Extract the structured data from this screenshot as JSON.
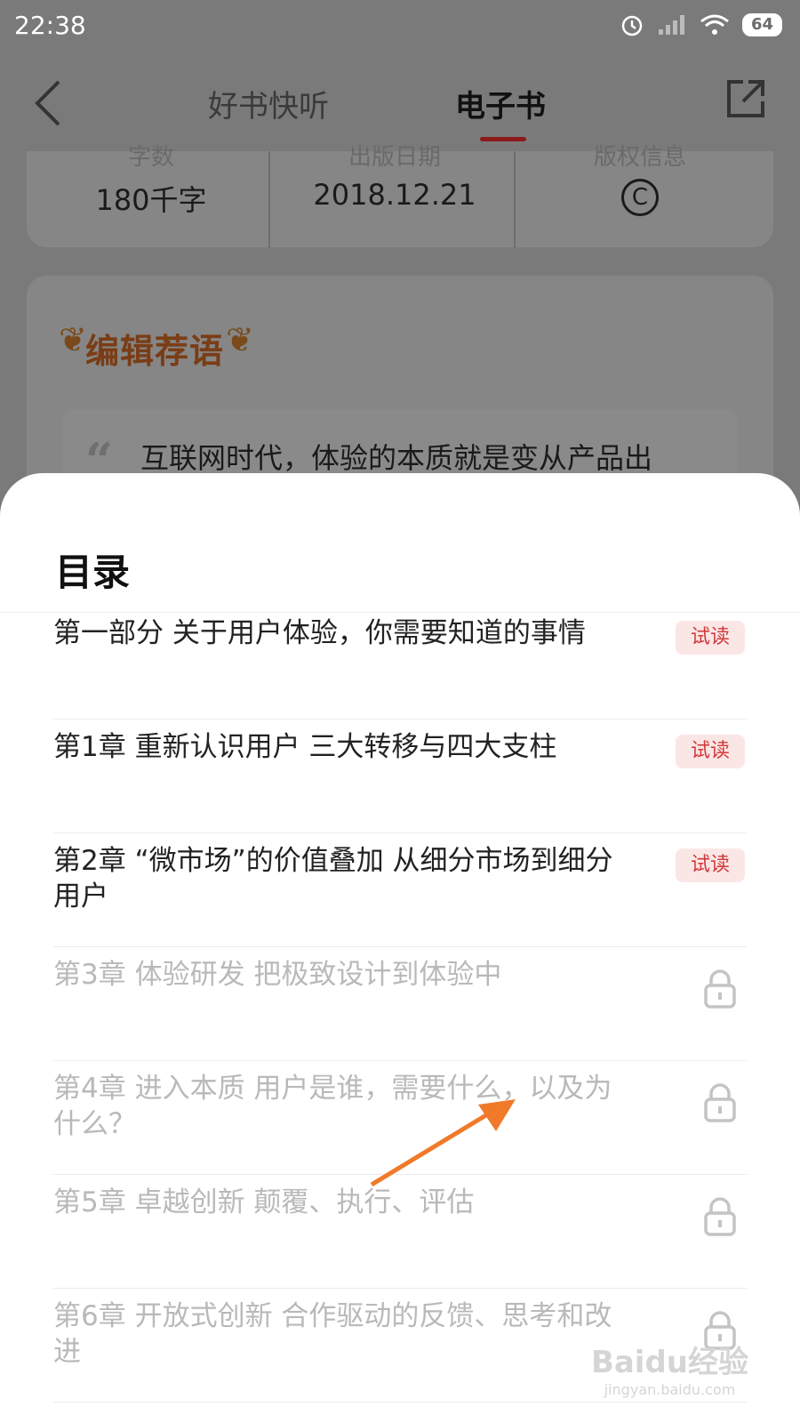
{
  "status_bar": {
    "time": "22:38",
    "battery": "64"
  },
  "nav": {
    "tab_listen": "好书快听",
    "tab_ebook": "电子书"
  },
  "info": {
    "words_label": "字数",
    "words_value": "180千字",
    "date_label": "出版日期",
    "date_value": "2018.12.21",
    "copyright_label": "版权信息",
    "copyright_symbol": "C"
  },
  "editor": {
    "title": "编辑荐语",
    "quote": "互联网时代，体验的本质就是变从产品出"
  },
  "toc": {
    "title": "目录",
    "trial_label": "试读",
    "items": [
      {
        "text": "第一部分 关于用户体验，你需要知道的事情",
        "status": "trial"
      },
      {
        "text": "第1章 重新认识用户 三大转移与四大支柱",
        "status": "trial"
      },
      {
        "text": "第2章 “微市场”的价值叠加 从细分市场到细分用户",
        "status": "trial"
      },
      {
        "text": "第3章 体验研发 把极致设计到体验中",
        "status": "locked"
      },
      {
        "text": "第4章 进入本质 用户是谁，需要什么，以及为什么？",
        "status": "locked"
      },
      {
        "text": "第5章 卓越创新 颠覆、执行、评估",
        "status": "locked"
      },
      {
        "text": "第6章 开放式创新 合作驱动的反馈、思考和改进",
        "status": "locked"
      }
    ]
  },
  "watermark": {
    "logo": "Baidu经验",
    "url": "jingyan.baidu.com"
  },
  "colors": {
    "trial_text": "#d13a3a",
    "trial_bg": "#fbe6e6",
    "tab_underline": "#8d1a1a",
    "annotation_arrow": "#f07a2a"
  }
}
